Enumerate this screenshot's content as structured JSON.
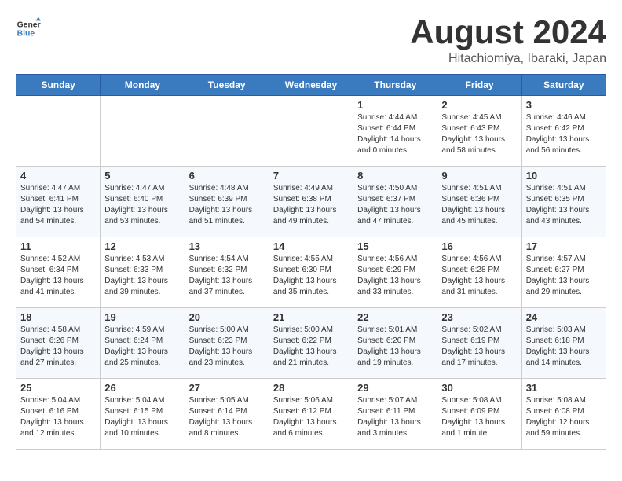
{
  "header": {
    "logo_general": "General",
    "logo_blue": "Blue",
    "month_title": "August 2024",
    "location": "Hitachiomiya, Ibaraki, Japan"
  },
  "weekdays": [
    "Sunday",
    "Monday",
    "Tuesday",
    "Wednesday",
    "Thursday",
    "Friday",
    "Saturday"
  ],
  "weeks": [
    [
      {
        "day": "",
        "info": ""
      },
      {
        "day": "",
        "info": ""
      },
      {
        "day": "",
        "info": ""
      },
      {
        "day": "",
        "info": ""
      },
      {
        "day": "1",
        "info": "Sunrise: 4:44 AM\nSunset: 6:44 PM\nDaylight: 14 hours\nand 0 minutes."
      },
      {
        "day": "2",
        "info": "Sunrise: 4:45 AM\nSunset: 6:43 PM\nDaylight: 13 hours\nand 58 minutes."
      },
      {
        "day": "3",
        "info": "Sunrise: 4:46 AM\nSunset: 6:42 PM\nDaylight: 13 hours\nand 56 minutes."
      }
    ],
    [
      {
        "day": "4",
        "info": "Sunrise: 4:47 AM\nSunset: 6:41 PM\nDaylight: 13 hours\nand 54 minutes."
      },
      {
        "day": "5",
        "info": "Sunrise: 4:47 AM\nSunset: 6:40 PM\nDaylight: 13 hours\nand 53 minutes."
      },
      {
        "day": "6",
        "info": "Sunrise: 4:48 AM\nSunset: 6:39 PM\nDaylight: 13 hours\nand 51 minutes."
      },
      {
        "day": "7",
        "info": "Sunrise: 4:49 AM\nSunset: 6:38 PM\nDaylight: 13 hours\nand 49 minutes."
      },
      {
        "day": "8",
        "info": "Sunrise: 4:50 AM\nSunset: 6:37 PM\nDaylight: 13 hours\nand 47 minutes."
      },
      {
        "day": "9",
        "info": "Sunrise: 4:51 AM\nSunset: 6:36 PM\nDaylight: 13 hours\nand 45 minutes."
      },
      {
        "day": "10",
        "info": "Sunrise: 4:51 AM\nSunset: 6:35 PM\nDaylight: 13 hours\nand 43 minutes."
      }
    ],
    [
      {
        "day": "11",
        "info": "Sunrise: 4:52 AM\nSunset: 6:34 PM\nDaylight: 13 hours\nand 41 minutes."
      },
      {
        "day": "12",
        "info": "Sunrise: 4:53 AM\nSunset: 6:33 PM\nDaylight: 13 hours\nand 39 minutes."
      },
      {
        "day": "13",
        "info": "Sunrise: 4:54 AM\nSunset: 6:32 PM\nDaylight: 13 hours\nand 37 minutes."
      },
      {
        "day": "14",
        "info": "Sunrise: 4:55 AM\nSunset: 6:30 PM\nDaylight: 13 hours\nand 35 minutes."
      },
      {
        "day": "15",
        "info": "Sunrise: 4:56 AM\nSunset: 6:29 PM\nDaylight: 13 hours\nand 33 minutes."
      },
      {
        "day": "16",
        "info": "Sunrise: 4:56 AM\nSunset: 6:28 PM\nDaylight: 13 hours\nand 31 minutes."
      },
      {
        "day": "17",
        "info": "Sunrise: 4:57 AM\nSunset: 6:27 PM\nDaylight: 13 hours\nand 29 minutes."
      }
    ],
    [
      {
        "day": "18",
        "info": "Sunrise: 4:58 AM\nSunset: 6:26 PM\nDaylight: 13 hours\nand 27 minutes."
      },
      {
        "day": "19",
        "info": "Sunrise: 4:59 AM\nSunset: 6:24 PM\nDaylight: 13 hours\nand 25 minutes."
      },
      {
        "day": "20",
        "info": "Sunrise: 5:00 AM\nSunset: 6:23 PM\nDaylight: 13 hours\nand 23 minutes."
      },
      {
        "day": "21",
        "info": "Sunrise: 5:00 AM\nSunset: 6:22 PM\nDaylight: 13 hours\nand 21 minutes."
      },
      {
        "day": "22",
        "info": "Sunrise: 5:01 AM\nSunset: 6:20 PM\nDaylight: 13 hours\nand 19 minutes."
      },
      {
        "day": "23",
        "info": "Sunrise: 5:02 AM\nSunset: 6:19 PM\nDaylight: 13 hours\nand 17 minutes."
      },
      {
        "day": "24",
        "info": "Sunrise: 5:03 AM\nSunset: 6:18 PM\nDaylight: 13 hours\nand 14 minutes."
      }
    ],
    [
      {
        "day": "25",
        "info": "Sunrise: 5:04 AM\nSunset: 6:16 PM\nDaylight: 13 hours\nand 12 minutes."
      },
      {
        "day": "26",
        "info": "Sunrise: 5:04 AM\nSunset: 6:15 PM\nDaylight: 13 hours\nand 10 minutes."
      },
      {
        "day": "27",
        "info": "Sunrise: 5:05 AM\nSunset: 6:14 PM\nDaylight: 13 hours\nand 8 minutes."
      },
      {
        "day": "28",
        "info": "Sunrise: 5:06 AM\nSunset: 6:12 PM\nDaylight: 13 hours\nand 6 minutes."
      },
      {
        "day": "29",
        "info": "Sunrise: 5:07 AM\nSunset: 6:11 PM\nDaylight: 13 hours\nand 3 minutes."
      },
      {
        "day": "30",
        "info": "Sunrise: 5:08 AM\nSunset: 6:09 PM\nDaylight: 13 hours\nand 1 minute."
      },
      {
        "day": "31",
        "info": "Sunrise: 5:08 AM\nSunset: 6:08 PM\nDaylight: 12 hours\nand 59 minutes."
      }
    ]
  ]
}
